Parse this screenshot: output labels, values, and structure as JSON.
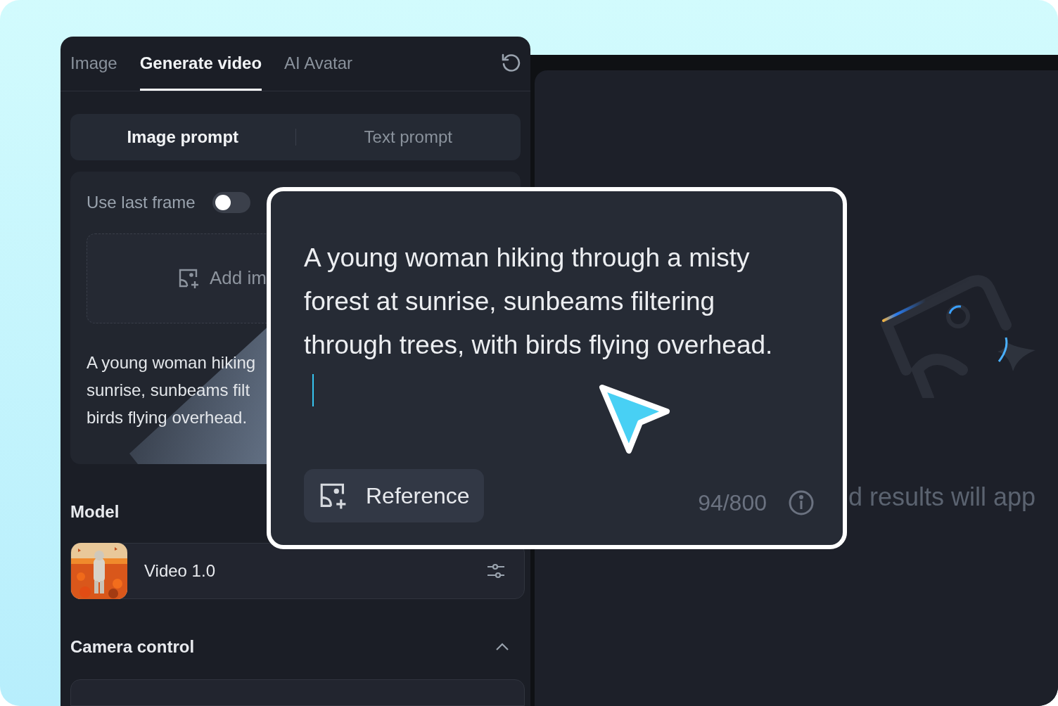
{
  "tabs": [
    {
      "label": "Image",
      "selected": false
    },
    {
      "label": "Generate video",
      "selected": true
    },
    {
      "label": "AI Avatar",
      "selected": false
    }
  ],
  "prompt_modes": [
    {
      "label": "Image prompt",
      "selected": true
    },
    {
      "label": "Text prompt",
      "selected": false
    }
  ],
  "use_last_frame": {
    "label": "Use last frame",
    "on": false
  },
  "add_image": {
    "label": "Add im"
  },
  "prompt_preview_lines": [
    "A young woman hiking",
    "sunrise, sunbeams filt",
    "birds flying overhead."
  ],
  "model": {
    "heading": "Model",
    "name": "Video 1.0"
  },
  "camera_control": {
    "heading": "Camera control",
    "expanded": true
  },
  "results_hint": "d results will app",
  "prompt_popup": {
    "text": "A young woman hiking through a misty forest at sunrise, sunbeams filtering through trees, with birds flying overhead.",
    "reference_button": "Reference",
    "char_count": "94/800"
  }
}
